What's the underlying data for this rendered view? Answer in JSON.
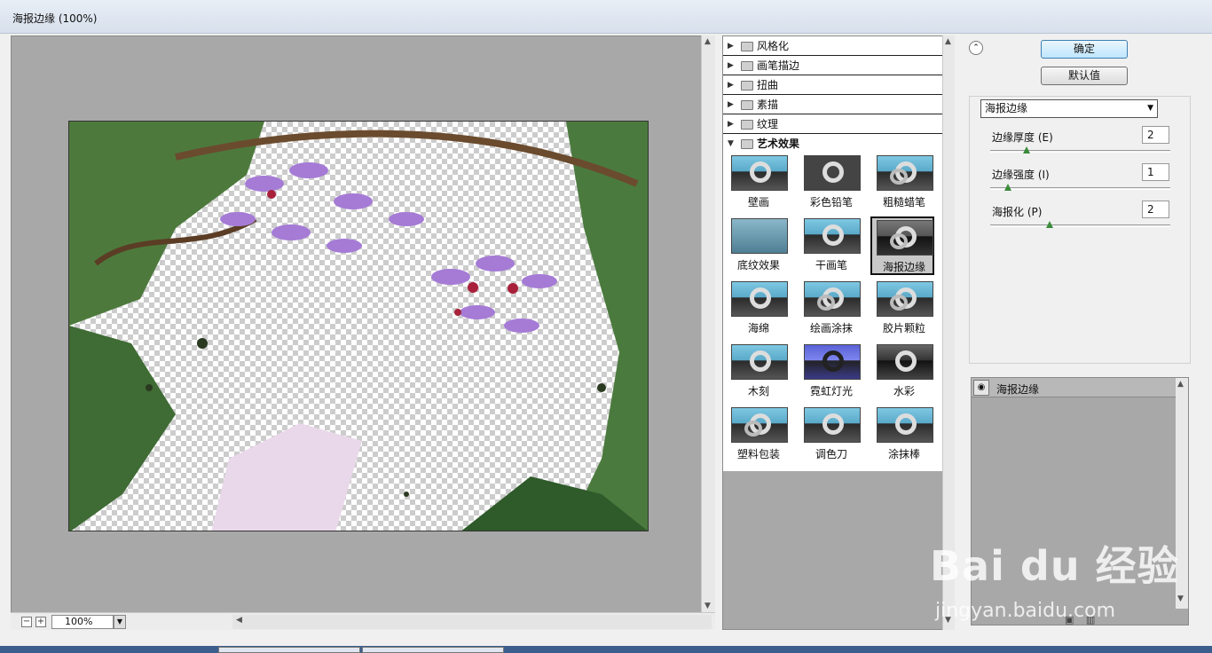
{
  "window": {
    "title": "海报边缘 (100%)"
  },
  "preview": {
    "zoom": "100%",
    "zoom_out": "−",
    "zoom_in": "+"
  },
  "categories": [
    {
      "label": "风格化",
      "open": false
    },
    {
      "label": "画笔描边",
      "open": false
    },
    {
      "label": "扭曲",
      "open": false
    },
    {
      "label": "素描",
      "open": false
    },
    {
      "label": "纹理",
      "open": false
    },
    {
      "label": "艺术效果",
      "open": true
    }
  ],
  "filters": [
    {
      "label": "壁画"
    },
    {
      "label": "彩色铅笔"
    },
    {
      "label": "粗糙蜡笔"
    },
    {
      "label": "底纹效果"
    },
    {
      "label": "干画笔"
    },
    {
      "label": "海报边缘",
      "selected": true
    },
    {
      "label": "海绵"
    },
    {
      "label": "绘画涂抹"
    },
    {
      "label": "胶片颗粒"
    },
    {
      "label": "木刻"
    },
    {
      "label": "霓虹灯光"
    },
    {
      "label": "水彩"
    },
    {
      "label": "塑料包装"
    },
    {
      "label": "调色刀"
    },
    {
      "label": "涂抹棒"
    }
  ],
  "buttons": {
    "ok": "确定",
    "default": "默认值"
  },
  "filter_select": {
    "value": "海报边缘"
  },
  "params": [
    {
      "label": "边缘厚度 (E)",
      "value": "2",
      "level": 0.2
    },
    {
      "label": "边缘强度 (I)",
      "value": "1",
      "level": 0.1
    },
    {
      "label": "海报化 (P)",
      "value": "2",
      "level": 0.33
    }
  ],
  "layers": {
    "items": [
      {
        "label": "海报边缘"
      }
    ]
  },
  "watermark": {
    "line1": "Bai du 经验",
    "line2": "jingyan.baidu.com"
  }
}
